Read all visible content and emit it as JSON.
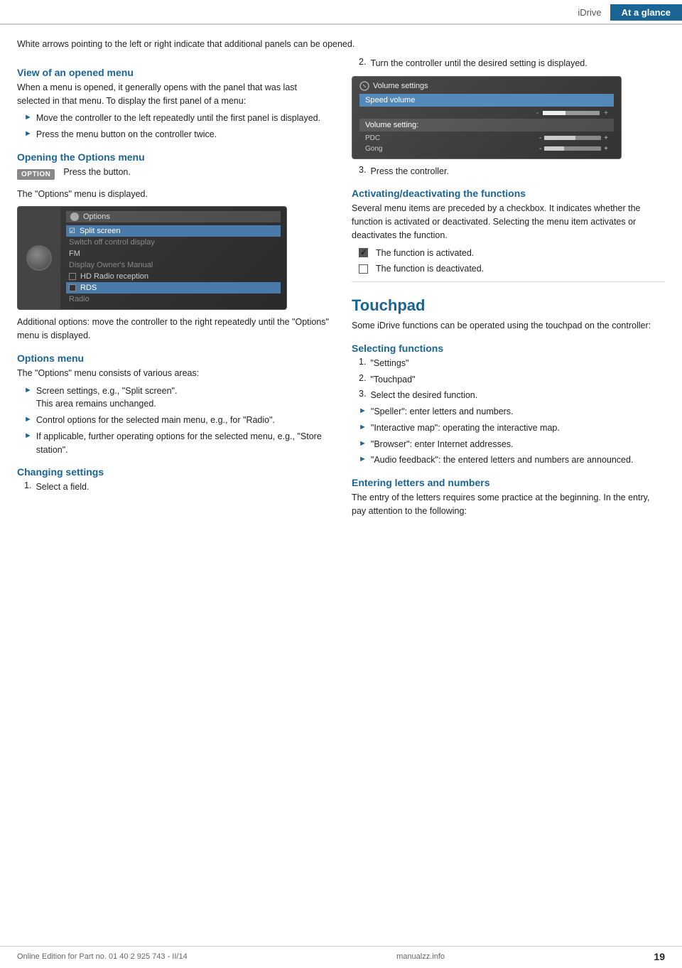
{
  "header": {
    "idrive_label": "iDrive",
    "ataglance_label": "At a glance"
  },
  "top_paragraph": "White arrows pointing to the left or right indicate that additional panels can be opened.",
  "left_col": {
    "view_heading": "View of an opened menu",
    "view_para": "When a menu is opened, it generally opens with the panel that was last selected in that menu. To display the first panel of a menu:",
    "view_bullets": [
      "Move the controller to the left repeatedly until the first panel is displayed.",
      "Press the menu button on the controller twice."
    ],
    "opening_heading": "Opening the Options menu",
    "options_button_label": "OPTION",
    "press_button_text": "Press the button.",
    "options_displayed_text": "The \"Options\" menu is displayed.",
    "additional_options_text": "Additional options: move the controller to the right repeatedly until the \"Options\" menu is displayed.",
    "options_menu_heading": "Options menu",
    "options_menu_intro": "The \"Options\" menu consists of various areas:",
    "options_menu_bullets": [
      {
        "main": "Screen settings, e.g., \"Split screen\".",
        "sub": "This area remains unchanged."
      },
      {
        "main": "Control options for the selected main menu, e.g., for \"Radio\".",
        "sub": null
      },
      {
        "main": "If applicable, further operating options for the selected menu, e.g., \"Store station\".",
        "sub": null
      }
    ],
    "changing_heading": "Changing settings",
    "changing_num_items": [
      "Select a field."
    ],
    "options_screen": {
      "title": "Options",
      "items": [
        {
          "label": "Split screen",
          "style": "highlighted",
          "icon": "checkbox-checked"
        },
        {
          "label": "Switch off control display",
          "style": "dimmed",
          "icon": null
        },
        {
          "label": "FM",
          "style": "normal",
          "icon": null
        },
        {
          "label": "Display Owner's Manual",
          "style": "dimmed",
          "icon": null
        },
        {
          "label": "HD Radio reception",
          "style": "normal",
          "icon": "checkbox"
        },
        {
          "label": "RDS",
          "style": "highlighted-light",
          "icon": "checkbox"
        },
        {
          "label": "Radio",
          "style": "dimmed",
          "icon": null
        }
      ]
    }
  },
  "right_col": {
    "step2_text": "Turn the controller until the desired setting is displayed.",
    "step3_text": "Press the controller.",
    "activating_heading": "Activating/deactivating the functions",
    "activating_para": "Several menu items are preceded by a checkbox. It indicates whether the function is activated or deactivated. Selecting the menu item activates or deactivates the function.",
    "checkbox_activated_text": "The function is activated.",
    "checkbox_deactivated_text": "The function is deactivated.",
    "touchpad_heading": "Touchpad",
    "touchpad_para": "Some iDrive functions can be operated using the touchpad on the controller:",
    "selecting_heading": "Selecting functions",
    "selecting_items": [
      "\"Settings\"",
      "\"Touchpad\"",
      "Select the desired function."
    ],
    "selecting_bullets": [
      "\"Speller\": enter letters and numbers.",
      "\"Interactive map\": operating the interactive map.",
      "\"Browser\": enter Internet addresses.",
      "\"Audio feedback\": the entered letters and numbers are announced."
    ],
    "entering_heading": "Entering letters and numbers",
    "entering_para": "The entry of the letters requires some practice at the beginning. In the entry, pay attention to the following:",
    "volume_screen": {
      "title": "Volume settings",
      "items": [
        {
          "label": "Speed volume",
          "style": "active"
        },
        {
          "label": "Volume setting:",
          "style": "normal"
        },
        {
          "label": "PDC",
          "style": "normal",
          "bar_percent": 50
        },
        {
          "label": "Gong",
          "style": "normal",
          "bar_percent": 30
        }
      ]
    }
  },
  "footer": {
    "online_text": "Online Edition for Part no. 01 40 2 925 743 - II/14",
    "manual_url": "manualzz.info",
    "page_number": "19"
  }
}
